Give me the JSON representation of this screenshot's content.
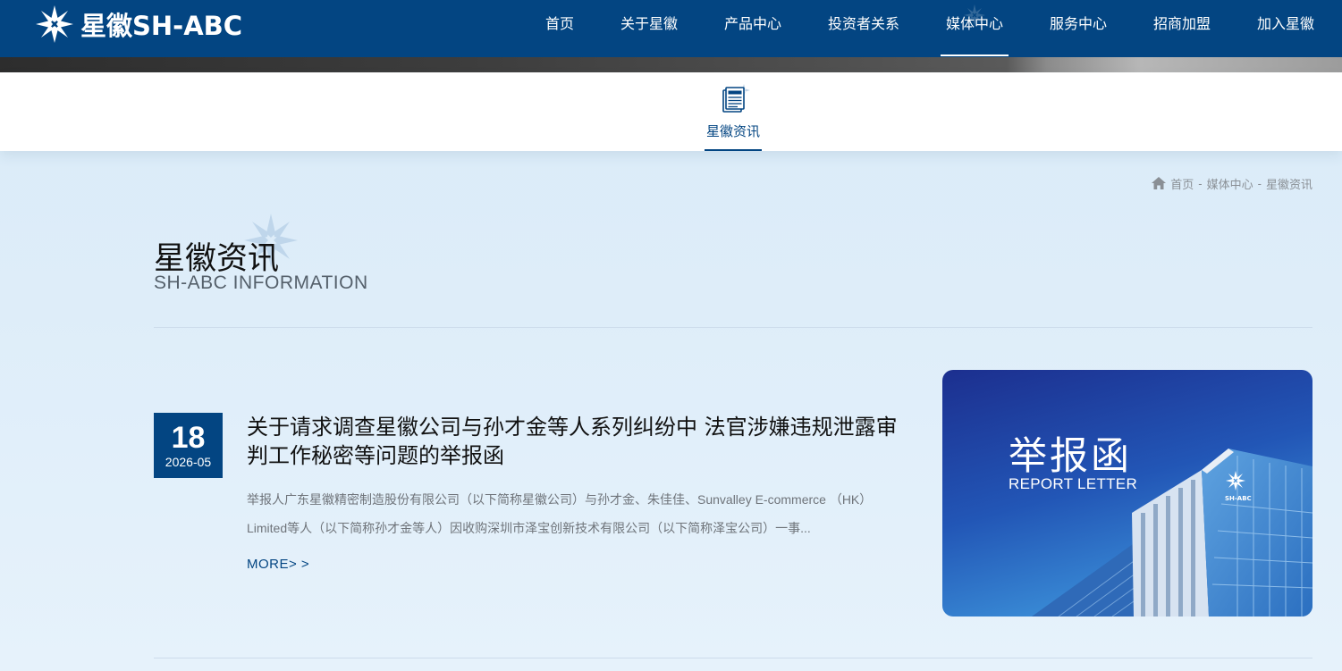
{
  "brand": {
    "logo_text": "星徽SH-ABC"
  },
  "nav": {
    "items": [
      {
        "label": "首页"
      },
      {
        "label": "关于星徽"
      },
      {
        "label": "产品中心"
      },
      {
        "label": "投资者关系"
      },
      {
        "label": "媒体中心",
        "active": true
      },
      {
        "label": "服务中心"
      },
      {
        "label": "招商加盟"
      },
      {
        "label": "加入星徽"
      }
    ]
  },
  "subnav": {
    "tab_label": "星徽资讯",
    "icon": "newspaper-icon"
  },
  "breadcrumb": {
    "items": [
      "首页",
      "媒体中心",
      "星徽资讯"
    ],
    "separator": "-",
    "icon": "home-icon"
  },
  "section": {
    "title": "星徽资讯",
    "subtitle": "SH-ABC INFORMATION"
  },
  "news": [
    {
      "day": "18",
      "year_month": "2026-05",
      "title": "关于请求调查星徽公司与孙才金等人系列纠纷中 法官涉嫌违规泄露审判工作秘密等问题的举报函",
      "excerpt": "举报人广东星徽精密制造股份有限公司（以下简称星徽公司）与孙才金、朱佳佳、Sunvalley E-commerce （HK） Limited等人（以下简称孙才金等人）因收购深圳市泽宝创新技术有限公司（以下简称泽宝公司）一事...",
      "more_label": "MORE> >",
      "thumb_title": "举报函",
      "thumb_subtitle": "REPORT LETTER"
    }
  ],
  "colors": {
    "primary": "#034582",
    "background": "#deedf9",
    "muted_text": "#6f747a"
  }
}
